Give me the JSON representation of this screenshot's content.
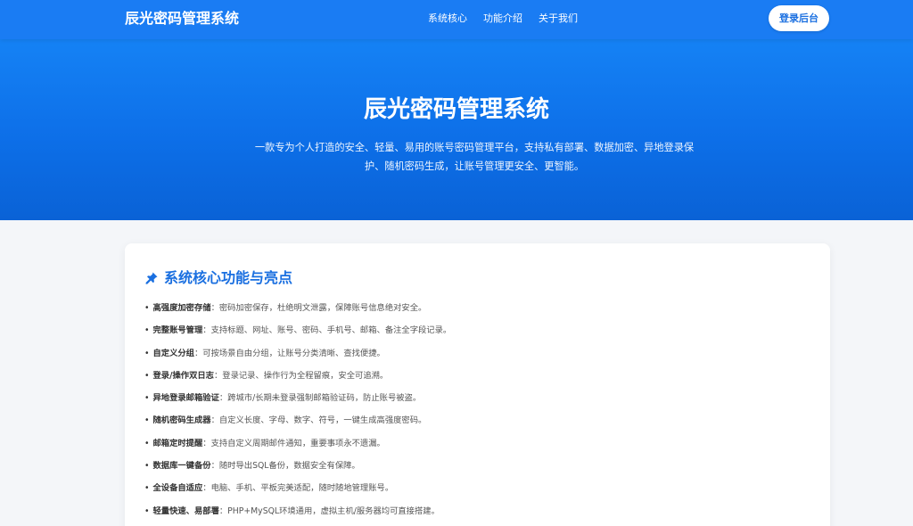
{
  "nav": {
    "brand": "辰光密码管理系统",
    "links": [
      "系统核心",
      "功能介绍",
      "关于我们"
    ],
    "login_label": "登录后台"
  },
  "hero": {
    "title": "辰光密码管理系统",
    "description": "一款专为个人打造的安全、轻量、易用的账号密码管理平台，支持私有部署、数据加密、异地登录保护、随机密码生成，让账号管理更安全、更智能。"
  },
  "features": {
    "title": "系统核心功能与亮点",
    "icon": "pin-icon",
    "accent_color": "#1a6fe0",
    "items": [
      {
        "label": "高强度加密存储",
        "desc": "：密码加密保存，杜绝明文泄露，保障账号信息绝对安全。"
      },
      {
        "label": "完整账号管理",
        "desc": "：支持标题、网址、账号、密码、手机号、邮箱、备注全字段记录。"
      },
      {
        "label": "自定义分组",
        "desc": "：可按场景自由分组，让账号分类清晰、查找便捷。"
      },
      {
        "label": "登录/操作双日志",
        "desc": "：登录记录、操作行为全程留痕，安全可追溯。"
      },
      {
        "label": "异地登录邮箱验证",
        "desc": "：跨城市/长期未登录强制邮箱验证码，防止账号被盗。"
      },
      {
        "label": "随机密码生成器",
        "desc": "：自定义长度、字母、数字、符号，一键生成高强度密码。"
      },
      {
        "label": "邮箱定时提醒",
        "desc": "：支持自定义周期邮件通知，重要事项永不遗漏。"
      },
      {
        "label": "数据库一键备份",
        "desc": "：随时导出SQL备份，数据安全有保障。"
      },
      {
        "label": "全设备自适应",
        "desc": "：电脑、手机、平板完美适配，随时随地管理账号。"
      },
      {
        "label": "轻量快速、易部署",
        "desc": "：PHP+MySQL环境通用，虚拟主机/服务器均可直接搭建。"
      }
    ]
  },
  "colors": {
    "nav_bg": "#1a7cf3",
    "hero_bg": "#0d6fe8",
    "page_bg": "#f4f6f9"
  }
}
